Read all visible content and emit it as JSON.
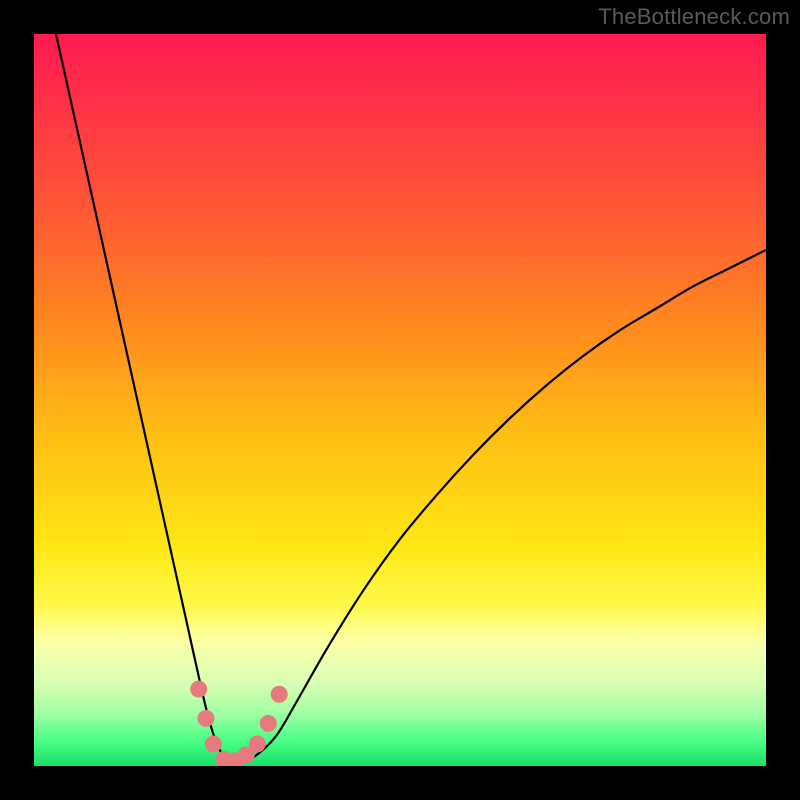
{
  "watermark": "TheBottleneck.com",
  "colors": {
    "frame": "#000000",
    "curve": "#000000",
    "marker_fill": "#e77a7e",
    "marker_stroke": "#c85a5e",
    "gradient_stops": [
      {
        "offset": 0.0,
        "color": "#ff1a4f"
      },
      {
        "offset": 0.1,
        "color": "#ff3347"
      },
      {
        "offset": 0.25,
        "color": "#ff5a33"
      },
      {
        "offset": 0.4,
        "color": "#ff8a1f"
      },
      {
        "offset": 0.55,
        "color": "#ffbf14"
      },
      {
        "offset": 0.7,
        "color": "#ffe714"
      },
      {
        "offset": 0.78,
        "color": "#fff94a"
      },
      {
        "offset": 0.83,
        "color": "#fdffa7"
      },
      {
        "offset": 0.89,
        "color": "#d6ffb3"
      },
      {
        "offset": 0.93,
        "color": "#9cffa1"
      },
      {
        "offset": 0.965,
        "color": "#4bff86"
      },
      {
        "offset": 1.0,
        "color": "#18e06a"
      }
    ]
  },
  "chart_data": {
    "type": "line",
    "title": "",
    "xlabel": "",
    "ylabel": "",
    "xlim": [
      0,
      100
    ],
    "ylim": [
      0,
      100
    ],
    "grid": false,
    "legend": false,
    "series": [
      {
        "name": "bottleneck-curve",
        "x": [
          3,
          5,
          7,
          9,
          11,
          13,
          15,
          17,
          19,
          21,
          23,
          24,
          25,
          26,
          27,
          28,
          30,
          33,
          36,
          40,
          45,
          50,
          55,
          60,
          65,
          70,
          75,
          80,
          85,
          90,
          95,
          100
        ],
        "y": [
          100,
          91,
          82,
          73,
          64,
          55,
          46,
          37,
          28,
          19,
          10,
          6,
          3,
          1.2,
          0.4,
          0.4,
          1.2,
          4,
          9,
          16,
          24,
          31,
          37,
          42.5,
          47.5,
          52,
          56,
          59.5,
          62.5,
          65.5,
          68,
          70.5
        ]
      }
    ],
    "markers": [
      {
        "x": 22.5,
        "y": 10.5
      },
      {
        "x": 23.5,
        "y": 6.5
      },
      {
        "x": 24.5,
        "y": 3.0
      },
      {
        "x": 26.0,
        "y": 0.9
      },
      {
        "x": 27.5,
        "y": 0.7
      },
      {
        "x": 29.0,
        "y": 1.5
      },
      {
        "x": 30.5,
        "y": 3.0
      },
      {
        "x": 32.0,
        "y": 5.8
      },
      {
        "x": 33.5,
        "y": 9.8
      }
    ]
  }
}
